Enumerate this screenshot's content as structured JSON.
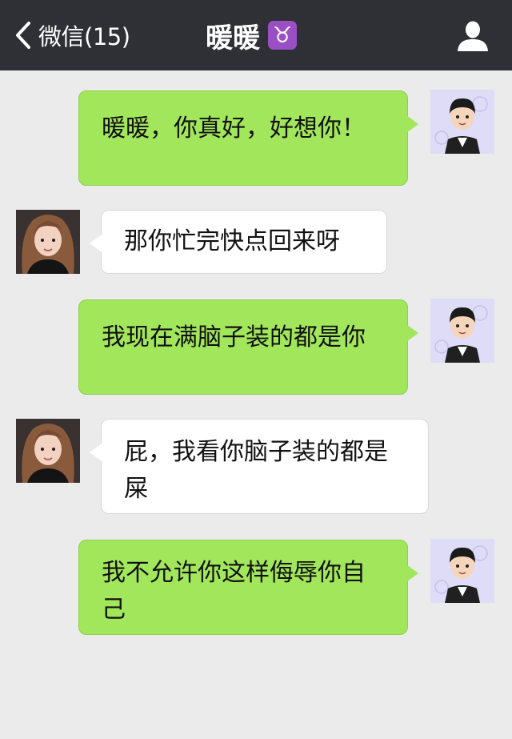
{
  "nav": {
    "back_label": "微信(15)",
    "title": "暖暖",
    "zodiac_glyph": "♉",
    "back_icon": "chevron-left-icon",
    "contact_icon": "person-icon"
  },
  "colors": {
    "navbar": "#2f3035",
    "chat_bg": "#ebebeb",
    "my_bubble": "#a2e65b",
    "their_bubble": "#ffffff",
    "zodiac_badge": "#9b4fc4"
  },
  "messages": [
    {
      "sender": "me",
      "text": "暖暖，你真好，好想你！"
    },
    {
      "sender": "them",
      "text": "那你忙完快点回来呀"
    },
    {
      "sender": "me",
      "text": "我现在满脑子装的都是你"
    },
    {
      "sender": "them",
      "text": "屁，我看你脑子装的都是屎"
    },
    {
      "sender": "me",
      "text": "我不允许你这样侮辱你自己"
    }
  ]
}
